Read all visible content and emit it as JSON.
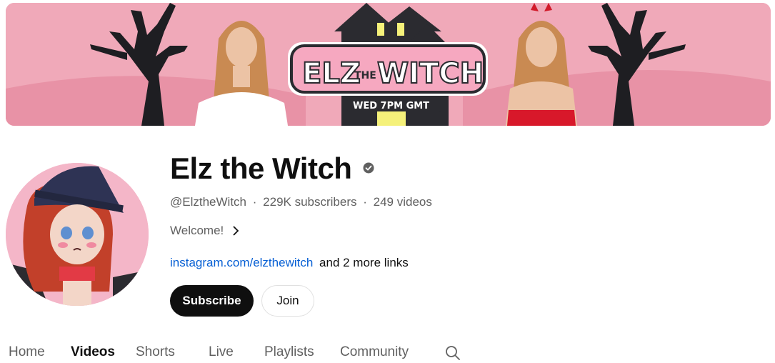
{
  "banner": {
    "logo_text_part1": "ELZ",
    "logo_text_the": "THE",
    "logo_text_part2": "WITCH",
    "schedule": "WED 7PM GMT"
  },
  "channel": {
    "name": "Elz the Witch",
    "handle": "@ElztheWitch",
    "separator": "·",
    "subscribers": "229K subscribers",
    "videos": "249 videos",
    "description": "Welcome!",
    "link_text": "instagram.com/elzthewitch",
    "more_links": "and 2 more links"
  },
  "buttons": {
    "subscribe": "Subscribe",
    "join": "Join"
  },
  "tabs": [
    {
      "label": "Home"
    },
    {
      "label": "Videos"
    },
    {
      "label": "Shorts"
    },
    {
      "label": "Live"
    },
    {
      "label": "Playlists"
    },
    {
      "label": "Community"
    }
  ],
  "active_tab": "Videos",
  "icons": [
    "verified-check-icon",
    "chevron-right-icon",
    "search-icon"
  ],
  "colors": {
    "banner_pink": "#f0a9b9",
    "link_blue": "#065fd4",
    "subscribe_bg": "#0f0f0f",
    "muted_text": "#606060"
  }
}
